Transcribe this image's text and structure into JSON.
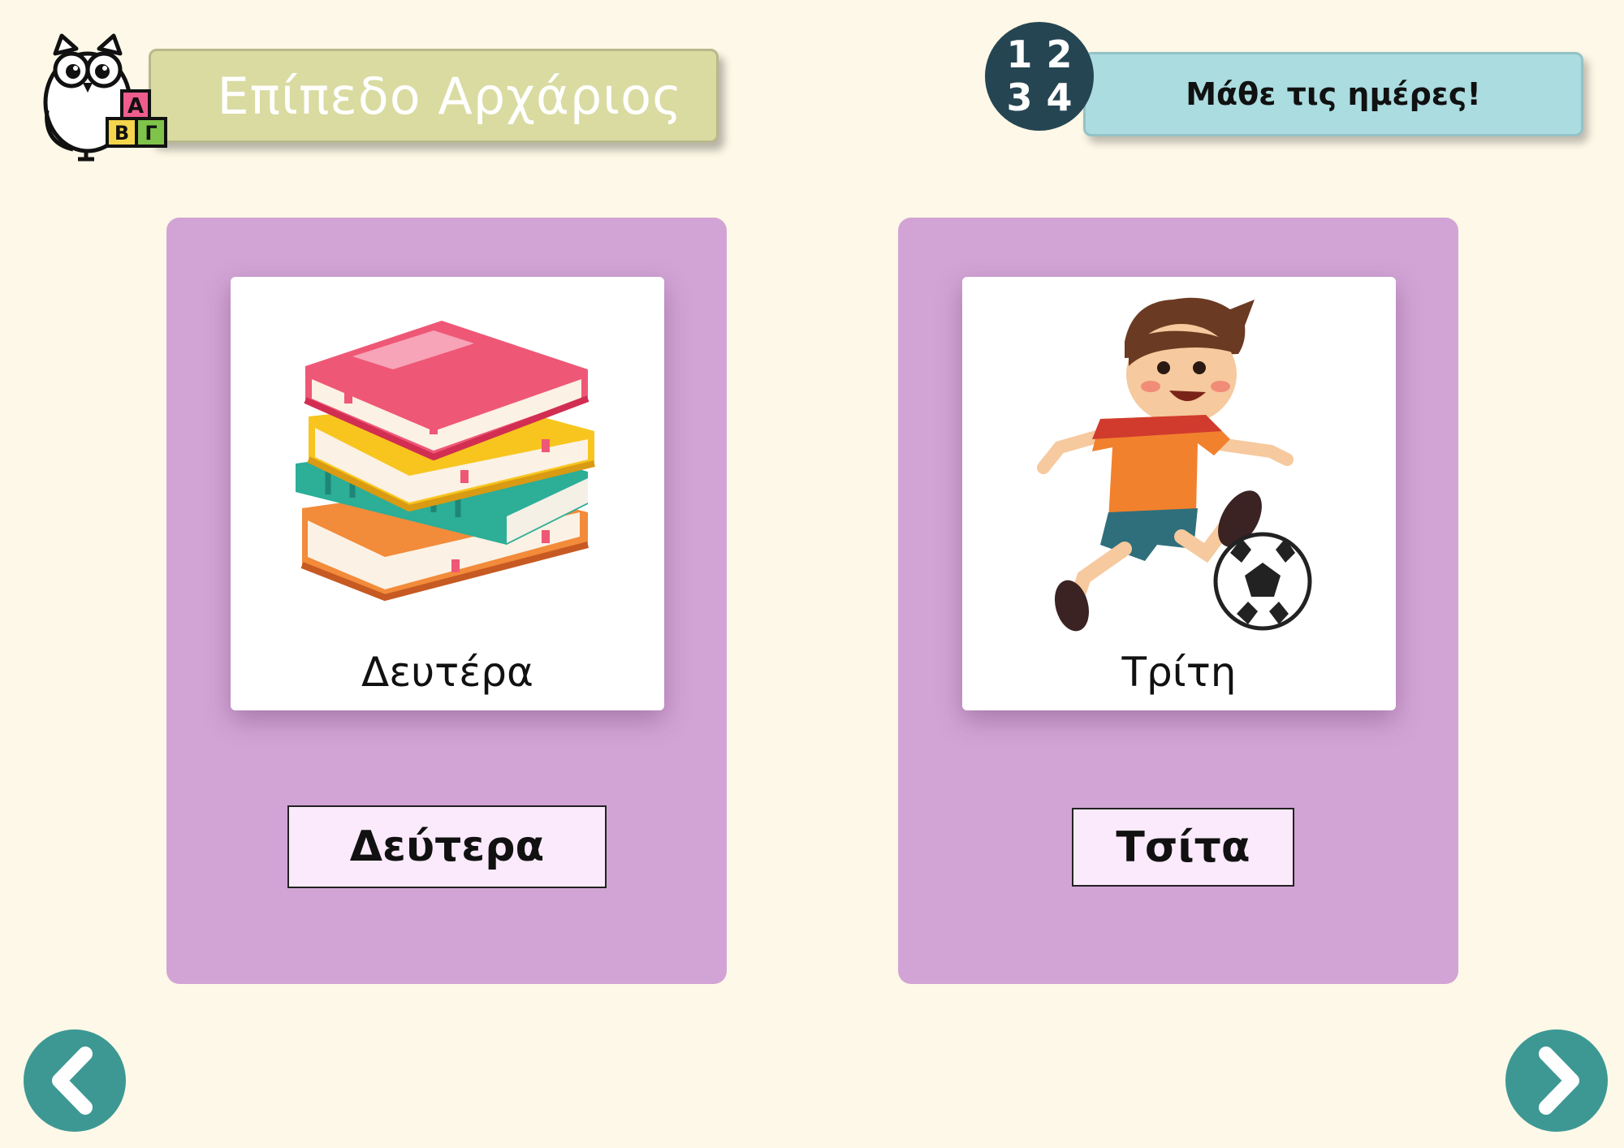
{
  "header": {
    "level_title": "Επίπεδο Αρχάριος",
    "topic_title": "Μάθε τις ημέρες!",
    "number_badge": [
      "1",
      "2",
      "3",
      "4"
    ],
    "logo_letters": [
      "A",
      "B",
      "Γ"
    ]
  },
  "cards": [
    {
      "image_icon": "stack-of-books",
      "caption": "Δευτέρα",
      "answer": "Δεύτερα"
    },
    {
      "image_icon": "boy-playing-football",
      "caption": "Τρίτη",
      "answer": "Τσίτα"
    }
  ],
  "navigation": {
    "prev_icon": "chevron-left-icon",
    "next_icon": "chevron-right-icon"
  },
  "colors": {
    "background": "#fdf8e7",
    "card": "#d2a4d5",
    "level_banner": "#d9dba1",
    "topic_banner": "#aadce0",
    "nav_button": "#3d9894",
    "badge": "#254552"
  }
}
